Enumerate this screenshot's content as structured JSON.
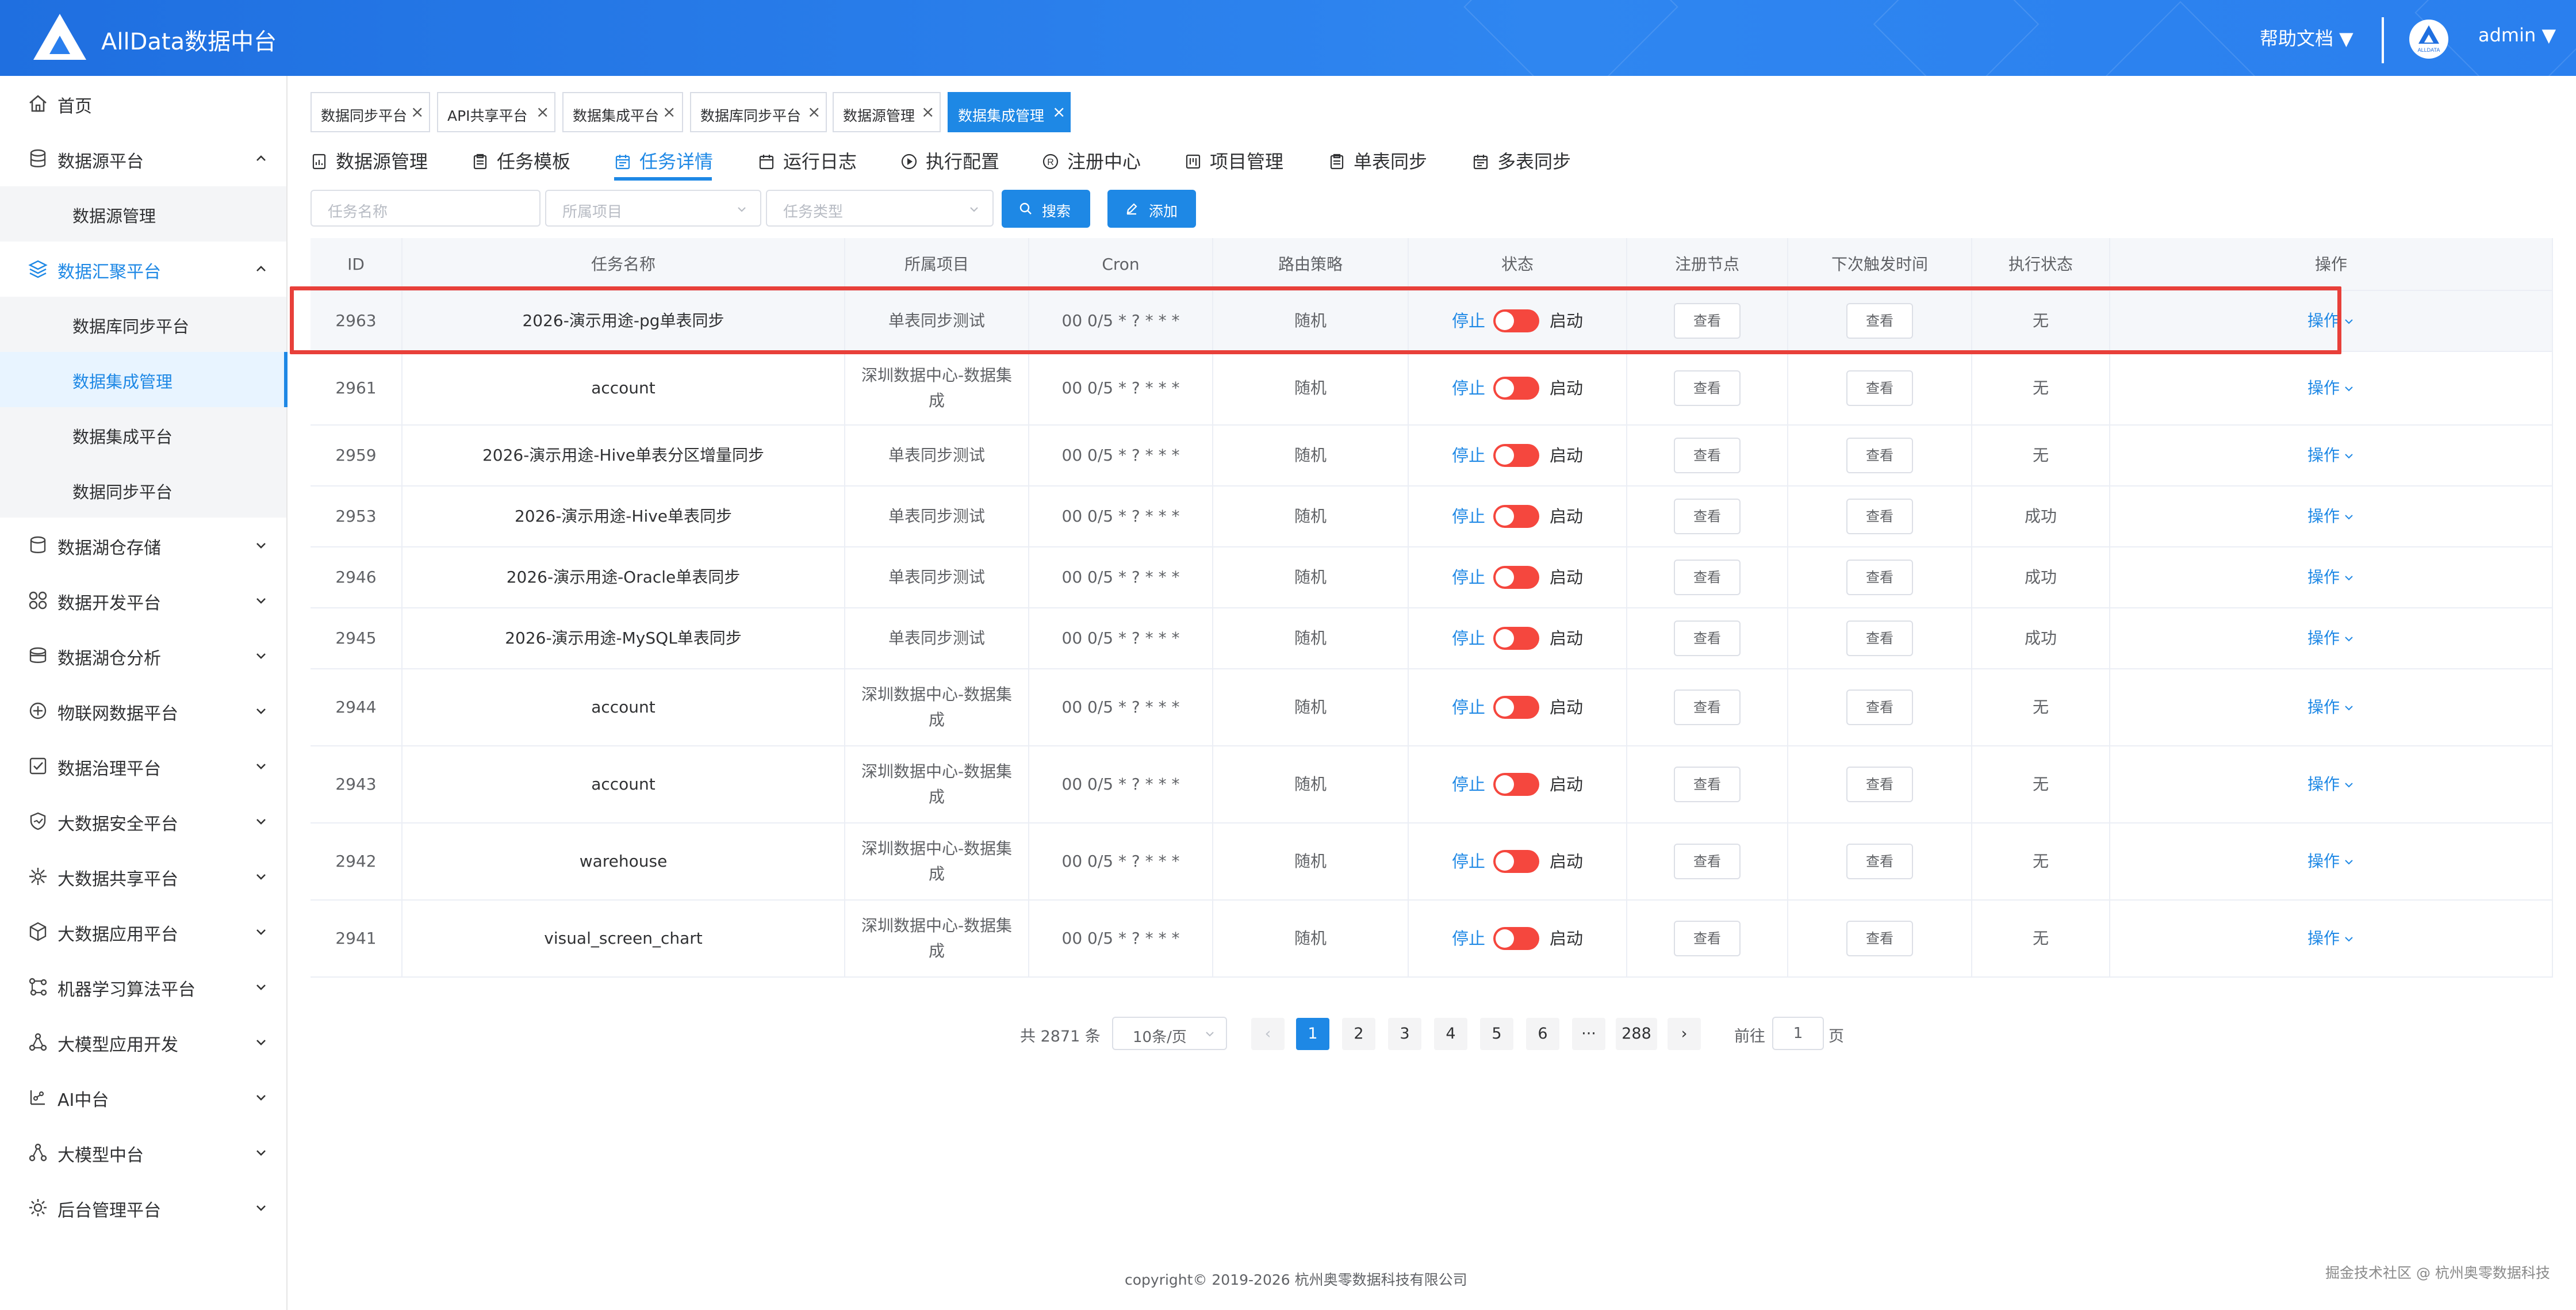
{
  "header": {
    "app_title": "AllData数据中台",
    "help_docs": "帮助文档 ▼",
    "user_name": "admin ▼",
    "avatar_text": "ALLDATA"
  },
  "sidebar": {
    "home": "首页",
    "datasource_platform": "数据源平台",
    "datasource_manage": "数据源管理",
    "data_aggregation_platform": "数据汇聚平台",
    "db_sync_platform": "数据库同步平台",
    "data_integration_manage": "数据集成管理",
    "data_integration_platform": "数据集成平台",
    "data_sync_platform": "数据同步平台",
    "lakehouse_storage": "数据湖仓存储",
    "data_dev_platform": "数据开发平台",
    "lakehouse_analysis": "数据湖仓分析",
    "iot_platform": "物联网数据平台",
    "governance_platform": "数据治理平台",
    "security_platform": "大数据安全平台",
    "sharing_platform": "大数据共享平台",
    "application_platform": "大数据应用平台",
    "ml_platform": "机器学习算法平台",
    "llm_app_dev": "大模型应用开发",
    "ai_center": "AI中台",
    "llm_center": "大模型中台",
    "admin_platform": "后台管理平台"
  },
  "tags": [
    {
      "label": "数据同步平台"
    },
    {
      "label": "API共享平台"
    },
    {
      "label": "数据集成平台"
    },
    {
      "label": "数据库同步平台"
    },
    {
      "label": "数据源管理"
    },
    {
      "label": "数据集成管理"
    }
  ],
  "tag_close": "×",
  "nav_tabs": [
    {
      "label": "数据源管理"
    },
    {
      "label": "任务模板"
    },
    {
      "label": "任务详情"
    },
    {
      "label": "运行日志"
    },
    {
      "label": "执行配置"
    },
    {
      "label": "注册中心"
    },
    {
      "label": "项目管理"
    },
    {
      "label": "单表同步"
    },
    {
      "label": "多表同步"
    }
  ],
  "filters": {
    "task_name_placeholder": "任务名称",
    "project_placeholder": "所属项目",
    "task_type_placeholder": "任务类型",
    "search_label": "搜索",
    "add_label": "添加"
  },
  "table": {
    "headers": [
      "ID",
      "任务名称",
      "所属项目",
      "Cron",
      "路由策略",
      "状态",
      "注册节点",
      "下次触发时间",
      "执行状态",
      "操作"
    ],
    "stop_label": "停止",
    "start_label": "启动",
    "view_label": "查看",
    "op_label": "操作",
    "rows": [
      {
        "id": "2963",
        "name": "2026-演示用途-pg单表同步",
        "project": "单表同步测试",
        "cron": "00 0/5 * ? * * *",
        "route": "随机",
        "exec_status": "无"
      },
      {
        "id": "2961",
        "name": "account",
        "project": "深圳数据中心-数据集成",
        "cron": "00 0/5 * ? * * *",
        "route": "随机",
        "exec_status": "无"
      },
      {
        "id": "2959",
        "name": "2026-演示用途-Hive单表分区增量同步",
        "project": "单表同步测试",
        "cron": "00 0/5 * ? * * *",
        "route": "随机",
        "exec_status": "无"
      },
      {
        "id": "2953",
        "name": "2026-演示用途-Hive单表同步",
        "project": "单表同步测试",
        "cron": "00 0/5 * ? * * *",
        "route": "随机",
        "exec_status": "成功"
      },
      {
        "id": "2946",
        "name": "2026-演示用途-Oracle单表同步",
        "project": "单表同步测试",
        "cron": "00 0/5 * ? * * *",
        "route": "随机",
        "exec_status": "成功"
      },
      {
        "id": "2945",
        "name": "2026-演示用途-MySQL单表同步",
        "project": "单表同步测试",
        "cron": "00 0/5 * ? * * *",
        "route": "随机",
        "exec_status": "成功"
      },
      {
        "id": "2944",
        "name": "account",
        "project": "深圳数据中心-数据集成",
        "cron": "00 0/5 * ? * * *",
        "route": "随机",
        "exec_status": "无"
      },
      {
        "id": "2943",
        "name": "account",
        "project": "深圳数据中心-数据集成",
        "cron": "00 0/5 * ? * * *",
        "route": "随机",
        "exec_status": "无"
      },
      {
        "id": "2942",
        "name": "warehouse",
        "project": "深圳数据中心-数据集成",
        "cron": "00 0/5 * ? * * *",
        "route": "随机",
        "exec_status": "无"
      },
      {
        "id": "2941",
        "name": "visual_screen_chart",
        "project": "深圳数据中心-数据集成",
        "cron": "00 0/5 * ? * * *",
        "route": "随机",
        "exec_status": "无"
      }
    ]
  },
  "pagination": {
    "total": "共 2871 条",
    "page_size": "10条/页",
    "prev": "‹",
    "next": "›",
    "pages": [
      "1",
      "2",
      "3",
      "4",
      "5",
      "6",
      "···",
      "288"
    ],
    "current": "1",
    "goto_label": "前往",
    "goto_value": "1",
    "goto_suffix": "页"
  },
  "footer": {
    "copyright": "copyright© 2019-2026 杭州奥零数据科技有限公司",
    "watermark": "掘金技术社区 @ 杭州奥零数据科技"
  },
  "colors": {
    "primary": "#1e88e5",
    "header": "#2a7fee",
    "switch_off": "#f5473e",
    "highlight_border": "#e8403a"
  }
}
